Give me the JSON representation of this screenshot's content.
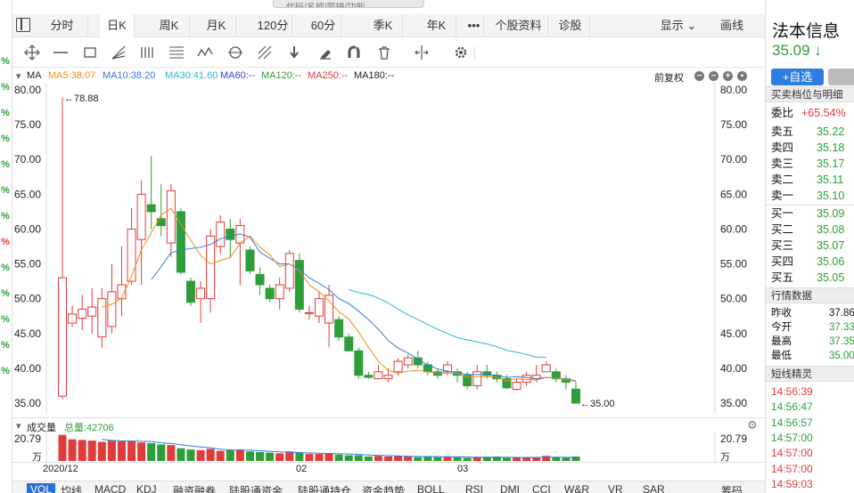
{
  "search": {
    "placeholder": "代码/名称/简拼/功能"
  },
  "tabs": [
    {
      "label": "分时",
      "active": false
    },
    {
      "label": "日K",
      "active": true
    },
    {
      "label": "周K",
      "active": false
    },
    {
      "label": "月K",
      "active": false
    },
    {
      "label": "120分",
      "active": false
    },
    {
      "label": "60分",
      "active": false
    },
    {
      "label": "季K",
      "active": false
    },
    {
      "label": "年K",
      "active": false
    },
    {
      "label": "•••",
      "active": false
    },
    {
      "label": "个股资料",
      "active": false
    },
    {
      "label": "诊股",
      "active": false
    }
  ],
  "tabbar_right": {
    "display": "显示",
    "draw": "画线"
  },
  "toolbar_icons": [
    "crosshair-icon",
    "horizontal-line-icon",
    "rectangle-icon",
    "fan-icon",
    "parallel-lines-icon",
    "fibonacci-icon",
    "wave-icon",
    "cycle-icon",
    "gann-icon",
    "arrow-down-icon",
    "eraser-icon",
    "magnet-icon",
    "trash-icon",
    "split-icon",
    "settings-icon"
  ],
  "ma": {
    "label": "MA",
    "ma5": "MA5:38.07",
    "ma10": "MA10:38.20",
    "ma30": "MA30:41.60",
    "ma60": "MA60:--",
    "ma120": "MA120:--",
    "ma250": "MA250:--",
    "ma180": "MA180:--",
    "adjust": "前复权",
    "colors": {
      "ma5": "#f08c1a",
      "ma10": "#2f7de1",
      "ma30": "#2ab7d6",
      "ma60": "#3344dd",
      "ma120": "#2e9e3a",
      "ma250": "#e23b3b",
      "ma180": "#222222"
    }
  },
  "chart_data": {
    "type": "candlestick",
    "ylim": [
      35,
      80
    ],
    "y_ticks": [
      "80.00",
      "75.00",
      "70.00",
      "65.00",
      "60.00",
      "55.00",
      "50.00",
      "45.00",
      "40.00",
      "35.00"
    ],
    "max_label": "78.88",
    "min_label": "35.00",
    "candles": [
      [
        36.0,
        53.0,
        78.9,
        35.5
      ],
      [
        46.5,
        47.8,
        49.0,
        46.0
      ],
      [
        47.2,
        48.5,
        50.5,
        45.5
      ],
      [
        47.5,
        48.8,
        51.5,
        45.0
      ],
      [
        44.5,
        50.0,
        51.5,
        43.0
      ],
      [
        46.0,
        51.0,
        55.0,
        45.0
      ],
      [
        50.0,
        52.0,
        57.5,
        47.5
      ],
      [
        52.5,
        60.0,
        63.0,
        52.0
      ],
      [
        58.5,
        65.0,
        67.0,
        52.0
      ],
      [
        63.5,
        62.5,
        70.5,
        60.0
      ],
      [
        61.5,
        60.5,
        66.5,
        59.0
      ],
      [
        58.0,
        65.5,
        66.5,
        56.0
      ],
      [
        62.5,
        53.8,
        63.0,
        53.5
      ],
      [
        52.5,
        49.5,
        53.0,
        49.0
      ],
      [
        50.0,
        51.5,
        52.5,
        46.5
      ],
      [
        50.0,
        59.0,
        60.0,
        48.0
      ],
      [
        57.5,
        61.0,
        62.0,
        56.5
      ],
      [
        60.0,
        58.5,
        61.5,
        56.0
      ],
      [
        58.0,
        60.5,
        61.5,
        52.0
      ],
      [
        57.0,
        54.0,
        57.5,
        53.5
      ],
      [
        53.5,
        52.0,
        54.5,
        50.5
      ],
      [
        51.5,
        50.0,
        52.0,
        49.5
      ],
      [
        50.0,
        52.0,
        53.0,
        48.5
      ],
      [
        51.5,
        56.5,
        57.0,
        51.0
      ],
      [
        55.5,
        48.5,
        56.5,
        48.0
      ],
      [
        48.0,
        48.0,
        49.0,
        47.0
      ],
      [
        47.5,
        50.0,
        51.0,
        46.5
      ],
      [
        46.5,
        50.5,
        52.0,
        43.0
      ],
      [
        47.0,
        44.5,
        47.5,
        44.0
      ],
      [
        44.5,
        42.5,
        45.0,
        42.5
      ],
      [
        42.5,
        39.0,
        43.0,
        38.5
      ],
      [
        39.0,
        38.7,
        39.5,
        38.5
      ],
      [
        38.5,
        39.5,
        40.5,
        38.5
      ],
      [
        38.5,
        39.0,
        40.0,
        38.0
      ],
      [
        39.5,
        41.0,
        41.5,
        39.0
      ],
      [
        40.5,
        41.5,
        42.0,
        40.0
      ],
      [
        41.5,
        40.5,
        42.5,
        40.0
      ],
      [
        40.5,
        39.5,
        41.0,
        39.0
      ],
      [
        39.5,
        39.0,
        40.0,
        38.5
      ],
      [
        39.5,
        40.5,
        41.0,
        39.0
      ],
      [
        39.5,
        39.0,
        40.0,
        38.0
      ],
      [
        39.0,
        37.5,
        39.5,
        37.0
      ],
      [
        37.5,
        39.5,
        40.5,
        37.0
      ],
      [
        39.5,
        39.0,
        40.5,
        38.5
      ],
      [
        39.0,
        38.5,
        39.5,
        38.0
      ],
      [
        38.5,
        37.2,
        39.0,
        37.0
      ],
      [
        37.0,
        38.0,
        38.5,
        36.8
      ],
      [
        38.0,
        39.0,
        39.5,
        37.5
      ],
      [
        38.5,
        39.0,
        40.5,
        38.0
      ],
      [
        39.5,
        40.5,
        41.0,
        39.5
      ],
      [
        39.5,
        38.5,
        40.0,
        38.0
      ],
      [
        38.5,
        38.0,
        39.0,
        37.0
      ],
      [
        37.0,
        35.0,
        38.0,
        35.0
      ]
    ],
    "ma5": [
      null,
      null,
      null,
      null,
      48.8,
      49.2,
      50.1,
      53.2,
      57.0,
      59.5,
      62.0,
      63.0,
      60.7,
      58.4,
      56.2,
      55.0,
      55.5,
      55.9,
      58.0,
      59.0,
      57.4,
      56.3,
      54.6,
      55.0,
      54.0,
      52.0,
      51.0,
      49.7,
      48.1,
      47.1,
      45.2,
      43.0,
      41.0,
      39.7,
      39.3,
      39.6,
      39.7,
      39.5,
      39.3,
      39.3,
      39.3,
      38.7,
      38.8,
      38.8,
      38.7,
      38.2,
      38.5,
      38.4,
      38.3,
      38.7,
      38.6,
      38.4,
      38.1
    ],
    "ma10": [
      null,
      null,
      null,
      null,
      null,
      null,
      null,
      null,
      null,
      52.7,
      54.6,
      56.6,
      57.0,
      57.2,
      57.4,
      57.8,
      58.6,
      59.0,
      59.3,
      58.8,
      56.7,
      55.8,
      55.0,
      55.0,
      54.2,
      53.0,
      52.2,
      51.3,
      50.0,
      49.3,
      48.2,
      47.0,
      45.6,
      44.0,
      42.9,
      42.2,
      41.3,
      40.5,
      39.9,
      39.6,
      39.4,
      39.1,
      39.1,
      39.1,
      39.0,
      38.7,
      38.8,
      38.7,
      38.5,
      38.7,
      38.6,
      38.5,
      38.2
    ],
    "ma30": [
      null,
      null,
      null,
      null,
      null,
      null,
      null,
      null,
      null,
      null,
      null,
      null,
      null,
      null,
      null,
      null,
      null,
      null,
      null,
      null,
      null,
      null,
      null,
      null,
      null,
      null,
      null,
      null,
      null,
      51.3,
      50.9,
      50.6,
      50.1,
      49.4,
      48.5,
      47.7,
      47.0,
      46.3,
      45.6,
      45.0,
      44.4,
      44.1,
      43.8,
      43.5,
      43.1,
      42.6,
      42.3,
      42.0,
      41.6,
      41.6,
      null,
      null,
      null
    ],
    "volume_label": "20.79",
    "volume_unit": "万",
    "volume_ticks": [
      "20.79"
    ],
    "volumes": [
      20.5,
      17,
      16.5,
      16,
      15,
      16,
      15.5,
      16,
      14.5,
      14,
      13,
      12.5,
      10,
      9,
      8.5,
      9.5,
      8,
      8.5,
      9,
      7.5,
      7,
      6.5,
      6,
      7.5,
      6.5,
      5.5,
      5.5,
      6,
      5,
      4.5,
      4.5,
      3.5,
      4,
      3.5,
      4,
      3.5,
      3,
      3.5,
      3,
      3.5,
      3,
      2.5,
      3,
      3,
      3.5,
      2.5,
      2.5,
      3,
      2.5,
      4,
      3,
      2.5,
      3.5
    ],
    "vol_ma": [
      null,
      null,
      null,
      null,
      17,
      16.2,
      15.8,
      15.6,
      15.5,
      15.2,
      14.3,
      13.7,
      12.8,
      11.8,
      11,
      10.3,
      9.3,
      8.7,
      8.6,
      8.5,
      8,
      7.6,
      7.2,
      7,
      6.6,
      6.3,
      6.1,
      5.9,
      5.7,
      5.5,
      5.1,
      4.7,
      4.4,
      4.2,
      3.9,
      3.7,
      3.6,
      3.5,
      3.4,
      3.3,
      3.2,
      3.1,
      3,
      3,
      3,
      2.9,
      2.8,
      2.8,
      2.8,
      3,
      3,
      2.9,
      3
    ]
  },
  "volume": {
    "title": "成交量",
    "total": "总量:42706"
  },
  "dates": [
    "2020/12",
    "02",
    "03"
  ],
  "indicators": [
    {
      "label": "VOL",
      "active": true
    },
    {
      "label": "均线"
    },
    {
      "label": "MACD"
    },
    {
      "label": "KDJ"
    },
    {
      "label": "融资融券"
    },
    {
      "label": "陆股通资金"
    },
    {
      "label": "陆股通持仓"
    },
    {
      "label": "资金趋势"
    },
    {
      "label": "BOLL"
    },
    {
      "label": "RSI"
    },
    {
      "label": "DMI"
    },
    {
      "label": "CCI"
    },
    {
      "label": "W&R"
    },
    {
      "label": "VR"
    },
    {
      "label": "SAR"
    },
    {
      "label": "筹码"
    }
  ],
  "right_panel": {
    "name": "法本信息",
    "price": "35.09 ↓",
    "add_fav": "+自选",
    "order_book_title": "买卖档位与明细",
    "webi": {
      "label": "委比",
      "value": "+65.54%"
    },
    "asks": [
      {
        "label": "卖五",
        "value": "35.22"
      },
      {
        "label": "卖四",
        "value": "35.18"
      },
      {
        "label": "卖三",
        "value": "35.17"
      },
      {
        "label": "卖二",
        "value": "35.11"
      },
      {
        "label": "卖一",
        "value": "35.10"
      }
    ],
    "bids": [
      {
        "label": "买一",
        "value": "35.09"
      },
      {
        "label": "买二",
        "value": "35.08"
      },
      {
        "label": "买三",
        "value": "35.07"
      },
      {
        "label": "买四",
        "value": "35.06"
      },
      {
        "label": "买五",
        "value": "35.05"
      }
    ],
    "quote_title": "行情数据",
    "quotes": [
      {
        "label": "昨收",
        "value": "37.86"
      },
      {
        "label": "今开",
        "value": "37.33"
      },
      {
        "label": "最高",
        "value": "37.35"
      },
      {
        "label": "最低",
        "value": "35.00"
      }
    ],
    "elf_title": "短线精灵",
    "elf_times": [
      "14:56:39",
      "14:56:47",
      "14:56:57",
      "14:57:00",
      "14:57:00",
      "14:57:00",
      "14:59:03"
    ]
  },
  "left_strip": [
    "%",
    "%",
    "%",
    "%",
    "%",
    "%",
    "%",
    "%",
    "%",
    "%",
    "%",
    "%",
    "%"
  ]
}
